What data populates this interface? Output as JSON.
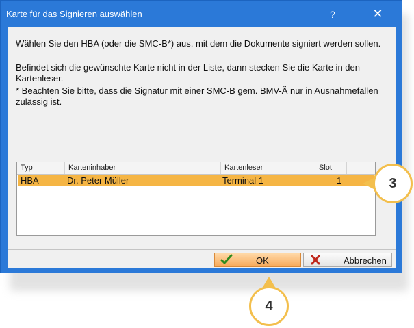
{
  "window": {
    "title": "Karte für das Signieren auswählen",
    "help": "?",
    "close": "✕"
  },
  "messages": {
    "p1": "Wählen Sie den HBA (oder die SMC-B*) aus, mit dem die Dokumente signiert werden sollen.",
    "p2": "Befindet sich die gewünschte Karte nicht in der Liste, dann stecken Sie die Karte in den Kartenleser.",
    "p3": "* Beachten Sie bitte, dass die Signatur mit einer SMC-B gem. BMV-Ä nur in Ausnahmefällen zulässig ist."
  },
  "table": {
    "columns": [
      "Typ",
      "Karteninhaber",
      "Kartenleser",
      "Slot"
    ],
    "rows": [
      {
        "typ": "HBA",
        "inhaber": "Dr. Peter Müller",
        "leser": "Terminal 1",
        "slot": "1"
      }
    ]
  },
  "buttons": {
    "ok": "OK",
    "cancel": "Abbrechen"
  },
  "callouts": {
    "three": "3",
    "four": "4"
  },
  "colors": {
    "titlebar": "#2b79d8",
    "selected_row": "#f5b544",
    "callout_border": "#f3bf4d"
  }
}
